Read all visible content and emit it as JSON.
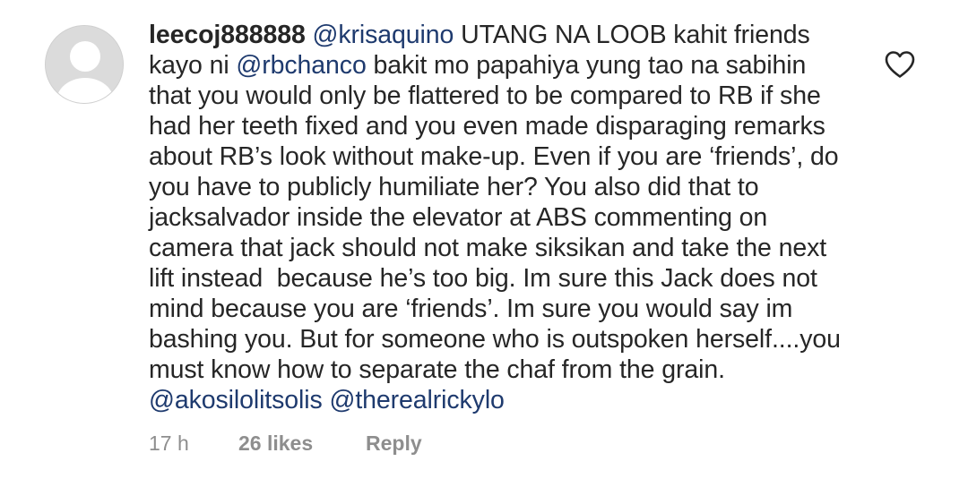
{
  "comment": {
    "username": "leecoj888888",
    "segments": [
      {
        "type": "mention",
        "text": "@krisaquino"
      },
      {
        "type": "text",
        "text": " UTANG NA LOOB kahit friends kayo ni "
      },
      {
        "type": "mention",
        "text": "@rbchanco"
      },
      {
        "type": "text",
        "text": " bakit mo papahiya yung tao na sabihin that you would only be flattered to be compared to RB if she had her teeth fixed and you even made disparaging remarks about RB’s look without make-up. Even if you are ‘friends’, do you have to publicly humiliate her? You also did that to jacksalvador inside the elevator at ABS commenting on camera that jack should not make siksikan and take the next lift instead  because he’s too big. Im sure this Jack does not mind because you are ‘friends’. Im sure you would say im bashing you. But for someone who is outspoken herself....you must know how to separate the chaf from the grain. "
      },
      {
        "type": "mention",
        "text": "@akosilolitsolis"
      },
      {
        "type": "text",
        "text": " "
      },
      {
        "type": "mention",
        "text": "@therealrickylo"
      }
    ],
    "time": "17 h",
    "likes": "26 likes",
    "reply_label": "Reply",
    "icons": {
      "avatar": "default-avatar-icon",
      "like": "heart-outline-icon"
    },
    "colors": {
      "text": "#262626",
      "mention": "#1e3a6e",
      "meta": "#8e8e8e",
      "avatar_bg": "#d9d9d9"
    }
  }
}
